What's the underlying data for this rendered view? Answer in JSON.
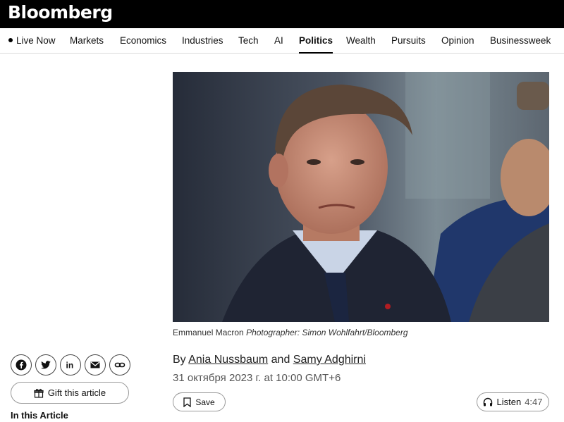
{
  "header": {
    "logo": "Bloomberg"
  },
  "nav": {
    "items": [
      {
        "label": "Live Now",
        "live": true
      },
      {
        "label": "Markets"
      },
      {
        "label": "Economics"
      },
      {
        "label": "Industries"
      },
      {
        "label": "Tech"
      },
      {
        "label": "AI"
      },
      {
        "label": "Politics",
        "active": true
      },
      {
        "label": "Wealth"
      },
      {
        "label": "Pursuits"
      },
      {
        "label": "Opinion"
      },
      {
        "label": "Businessweek"
      }
    ]
  },
  "article": {
    "caption_subject": "Emmanuel Macron",
    "caption_credit": "Photographer: Simon Wohlfahrt/Bloomberg",
    "byline_prefix": "By",
    "author_1": "Ania Nussbaum",
    "byline_and": "and",
    "author_2": "Samy Adghirni",
    "date": "31 октября 2023 г. at 10:00 GMT+6"
  },
  "share": {
    "icons": [
      "facebook-icon",
      "twitter-icon",
      "linkedin-icon",
      "email-icon",
      "link-icon"
    ]
  },
  "actions": {
    "gift_label": "Gift this article",
    "save_label": "Save",
    "listen_label": "Listen",
    "listen_duration": "4:47"
  },
  "sidebar": {
    "in_article_heading": "In this Article"
  }
}
